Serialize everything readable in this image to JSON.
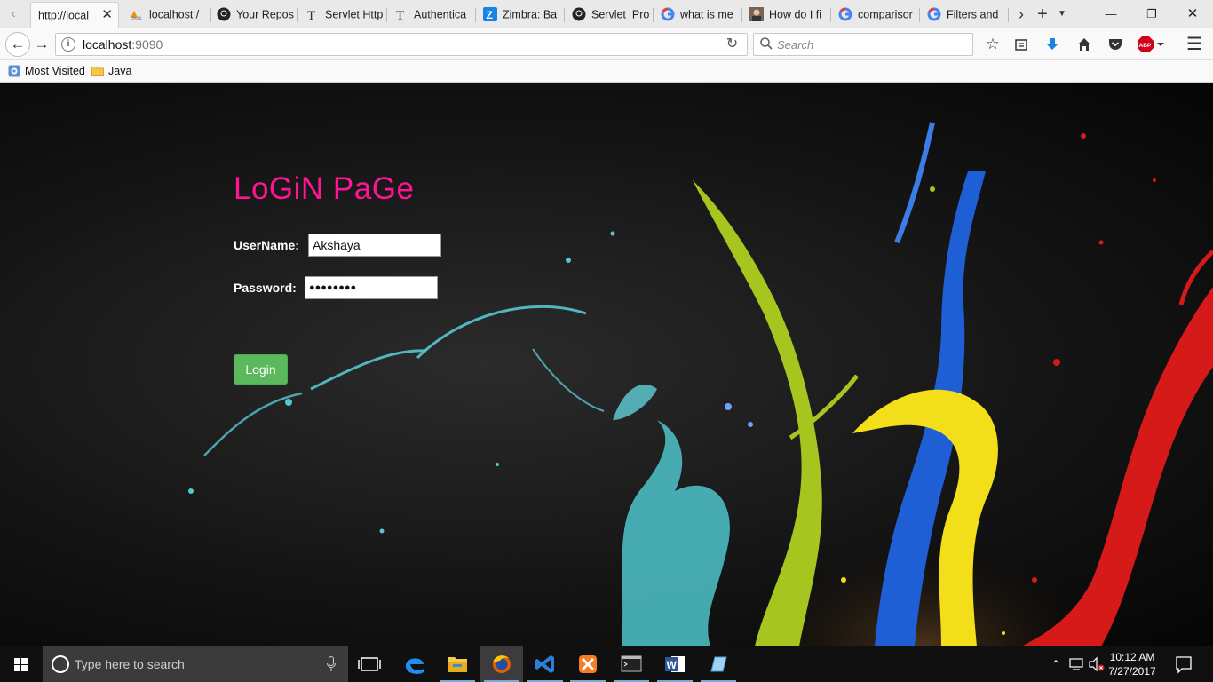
{
  "browser": {
    "tabs": [
      {
        "title": "http://local",
        "active": true,
        "icon": "page-icon"
      },
      {
        "title": "localhost /",
        "active": false,
        "icon": "phpmyadmin-icon"
      },
      {
        "title": "Your Repos",
        "active": false,
        "icon": "github-icon"
      },
      {
        "title": "Servlet Http",
        "active": false,
        "icon": "t-logo-icon"
      },
      {
        "title": "Authentica",
        "active": false,
        "icon": "t-logo-icon"
      },
      {
        "title": "Zimbra: Ba",
        "active": false,
        "icon": "zimbra-icon"
      },
      {
        "title": "Servlet_Pro",
        "active": false,
        "icon": "github-icon"
      },
      {
        "title": "what is me",
        "active": false,
        "icon": "google-icon"
      },
      {
        "title": "How do I fi",
        "active": false,
        "icon": "avatar-icon"
      },
      {
        "title": "comparisor",
        "active": false,
        "icon": "google-icon"
      },
      {
        "title": "Filters and",
        "active": false,
        "icon": "google-icon"
      }
    ],
    "url": {
      "host": "localhost",
      "port": ":9090"
    },
    "search_placeholder": "Search",
    "bookmarks": [
      {
        "label": "Most Visited",
        "icon": "most-visited-icon"
      },
      {
        "label": "Java",
        "icon": "folder-icon"
      }
    ],
    "abp_label": "ABP"
  },
  "page": {
    "title": "LoGiN PaGe",
    "username_label": "UserName:",
    "username_value": "Akshaya",
    "password_label": "Password:",
    "password_value": "●●●●●●●●",
    "login_button": "Login"
  },
  "taskbar": {
    "search_placeholder": "Type here to search",
    "time": "10:12 AM",
    "date": "7/27/2017"
  },
  "colors": {
    "title": "#ff1493",
    "login_button": "#5cb85c"
  }
}
